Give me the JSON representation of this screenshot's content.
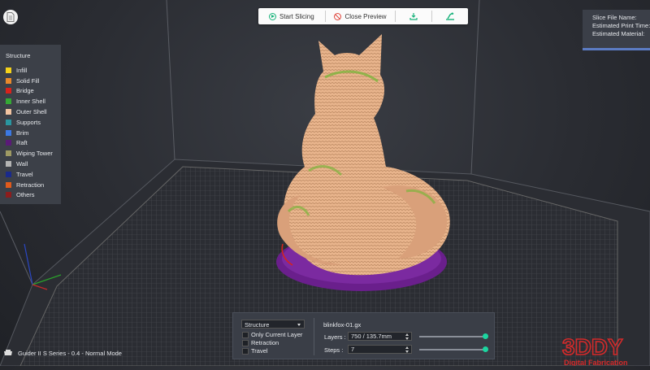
{
  "toolbar": {
    "start_label": "Start Slicing",
    "close_label": "Close Preview",
    "icons": [
      "export-icon",
      "print-icon"
    ]
  },
  "info_panel": {
    "slice_file_name_label": "Slice File Name:",
    "estimated_time_label": "Estimated Print Time:",
    "estimated_material_label": "Estimated Material:"
  },
  "legend": {
    "title": "Structure",
    "items": [
      {
        "label": "Infill",
        "color": "#f5d21a"
      },
      {
        "label": "Solid Fill",
        "color": "#e8892c"
      },
      {
        "label": "Bridge",
        "color": "#d8221c"
      },
      {
        "label": "Inner Shell",
        "color": "#35a835"
      },
      {
        "label": "Outer Shell",
        "color": "#f2c3a1"
      },
      {
        "label": "Supports",
        "color": "#2a96a0"
      },
      {
        "label": "Brim",
        "color": "#3b79e3"
      },
      {
        "label": "Raft",
        "color": "#5a1a78"
      },
      {
        "label": "Wiping Tower",
        "color": "#9e9a64"
      },
      {
        "label": "Wall",
        "color": "#b4b4b4"
      },
      {
        "label": "Travel",
        "color": "#1a2a8c"
      },
      {
        "label": "Retraction",
        "color": "#e05a1c"
      },
      {
        "label": "Others",
        "color": "#8c1d1d"
      }
    ]
  },
  "controls": {
    "structure_select": "Structure",
    "only_current_layer": "Only Current Layer",
    "retraction": "Retraction",
    "travel": "Travel",
    "file_name": "blinkfox-01.gx",
    "layers_label": "Layers :",
    "layers_value": "750 / 135.7mm",
    "steps_label": "Steps :",
    "steps_value": "7",
    "layers_slider_fraction": 1.0,
    "steps_slider_fraction": 1.0
  },
  "footer": {
    "model_label": "Guider II S Series - 0.4 - Normal Mode",
    "brand_main": "3DDY",
    "brand_sub": "Digital Fabrication"
  },
  "colors": {
    "accent_green": "#1bd6a0",
    "model_color": "#e8b48c",
    "raft_purple": "#6a1f8c"
  }
}
